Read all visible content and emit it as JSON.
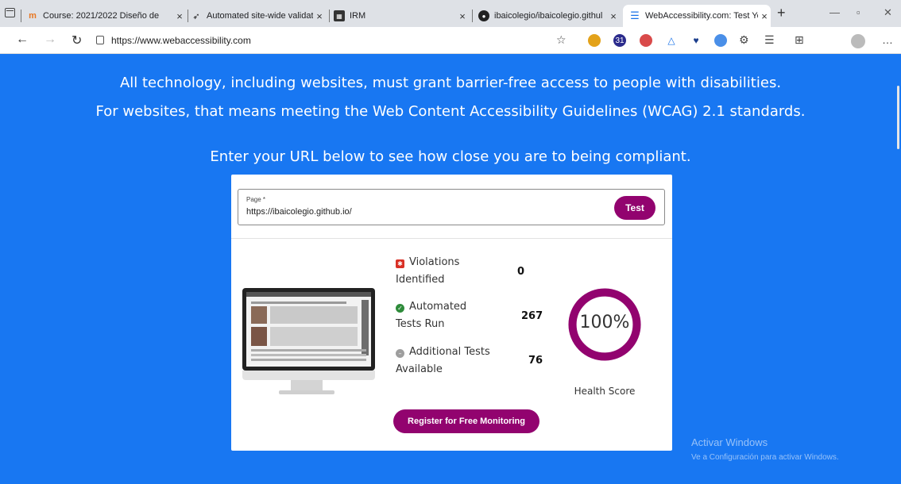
{
  "browser": {
    "tabs": [
      {
        "title": "Course: 2021/2022 Diseño de",
        "favicon": "moodle-icon",
        "active": false
      },
      {
        "title": "Automated site-wide validati",
        "favicon": "rocket-icon",
        "active": false
      },
      {
        "title": "IRM",
        "favicon": "irm-icon",
        "active": false
      },
      {
        "title": "ibaicolegio/ibaicolegio.githul",
        "favicon": "github-icon",
        "active": false
      },
      {
        "title": "WebAccessibility.com: Test Yo",
        "favicon": "menu-icon",
        "active": true
      }
    ],
    "url": "https://www.webaccessibility.com",
    "extension_badge": "31"
  },
  "hero": {
    "line1": "All technology, including websites, must grant barrier-free access to people with disabilities.",
    "line2": "For websites, that means meeting the Web Content Accessibility Guidelines (WCAG) 2.1 standards.",
    "line3": "Enter your URL below to see how close you are to being compliant."
  },
  "form": {
    "label": "Page *",
    "value": "https://ibaicolegio.github.io/",
    "button": "Test"
  },
  "results": {
    "violations_label_1": "Violations",
    "violations_label_2": "Identified",
    "violations_value": "0",
    "automated_label_1": "Automated",
    "automated_label_2": "Tests Run",
    "automated_value": "267",
    "additional_label_1": "Additional Tests",
    "additional_label_2": "Available",
    "additional_value": "76",
    "health_score": "100%",
    "health_fraction": 1.0,
    "health_label": "Health Score",
    "register_button": "Register for Free Monitoring"
  },
  "watermark": {
    "title": "Activar Windows",
    "subtitle": "Ve a Configuración para activar Windows."
  },
  "colors": {
    "page_bg": "#1877f2",
    "accent": "#92036f",
    "violation": "#d93025",
    "pass": "#2e8b3a",
    "neutral": "#9e9e9e"
  }
}
